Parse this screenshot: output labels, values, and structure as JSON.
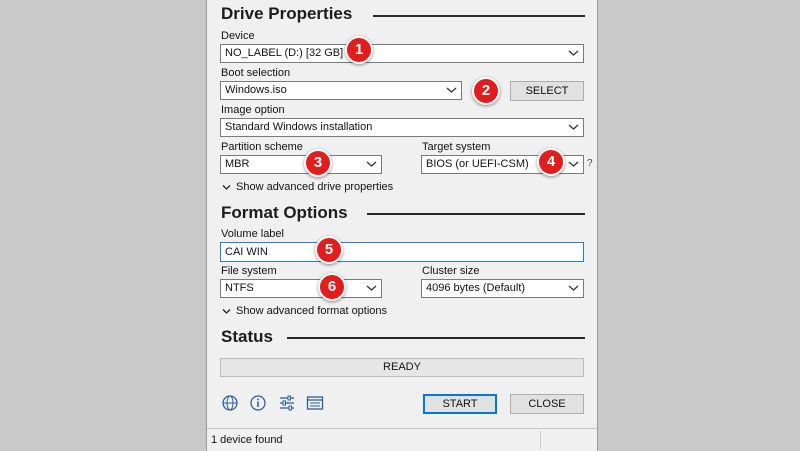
{
  "drive_properties": {
    "title": "Drive Properties",
    "device": {
      "label": "Device",
      "value": "NO_LABEL (D:) [32 GB]"
    },
    "boot_selection": {
      "label": "Boot selection",
      "value": "Windows.iso",
      "select_button": "SELECT"
    },
    "image_option": {
      "label": "Image option",
      "value": "Standard Windows installation"
    },
    "partition_scheme": {
      "label": "Partition scheme",
      "value": "MBR"
    },
    "target_system": {
      "label": "Target system",
      "value": "BIOS (or UEFI-CSM)",
      "help": "?"
    },
    "advanced_toggle": "Show advanced drive properties"
  },
  "format_options": {
    "title": "Format Options",
    "volume_label": {
      "label": "Volume label",
      "value": "CAI WIN"
    },
    "file_system": {
      "label": "File system",
      "value": "NTFS"
    },
    "cluster_size": {
      "label": "Cluster size",
      "value": "4096 bytes (Default)"
    },
    "advanced_toggle": "Show advanced format options"
  },
  "status": {
    "title": "Status",
    "text": "READY"
  },
  "actions": {
    "start": "START",
    "close": "CLOSE",
    "icons": [
      "globe-icon",
      "info-icon",
      "settings-sliders-icon",
      "log-icon"
    ]
  },
  "footer": {
    "text": "1 device found"
  },
  "annotations": [
    "1",
    "2",
    "3",
    "4",
    "5",
    "6"
  ],
  "colors": {
    "badge": "#e21d1d",
    "focus_border": "#2b7bd8",
    "accent": "#0078d7"
  }
}
